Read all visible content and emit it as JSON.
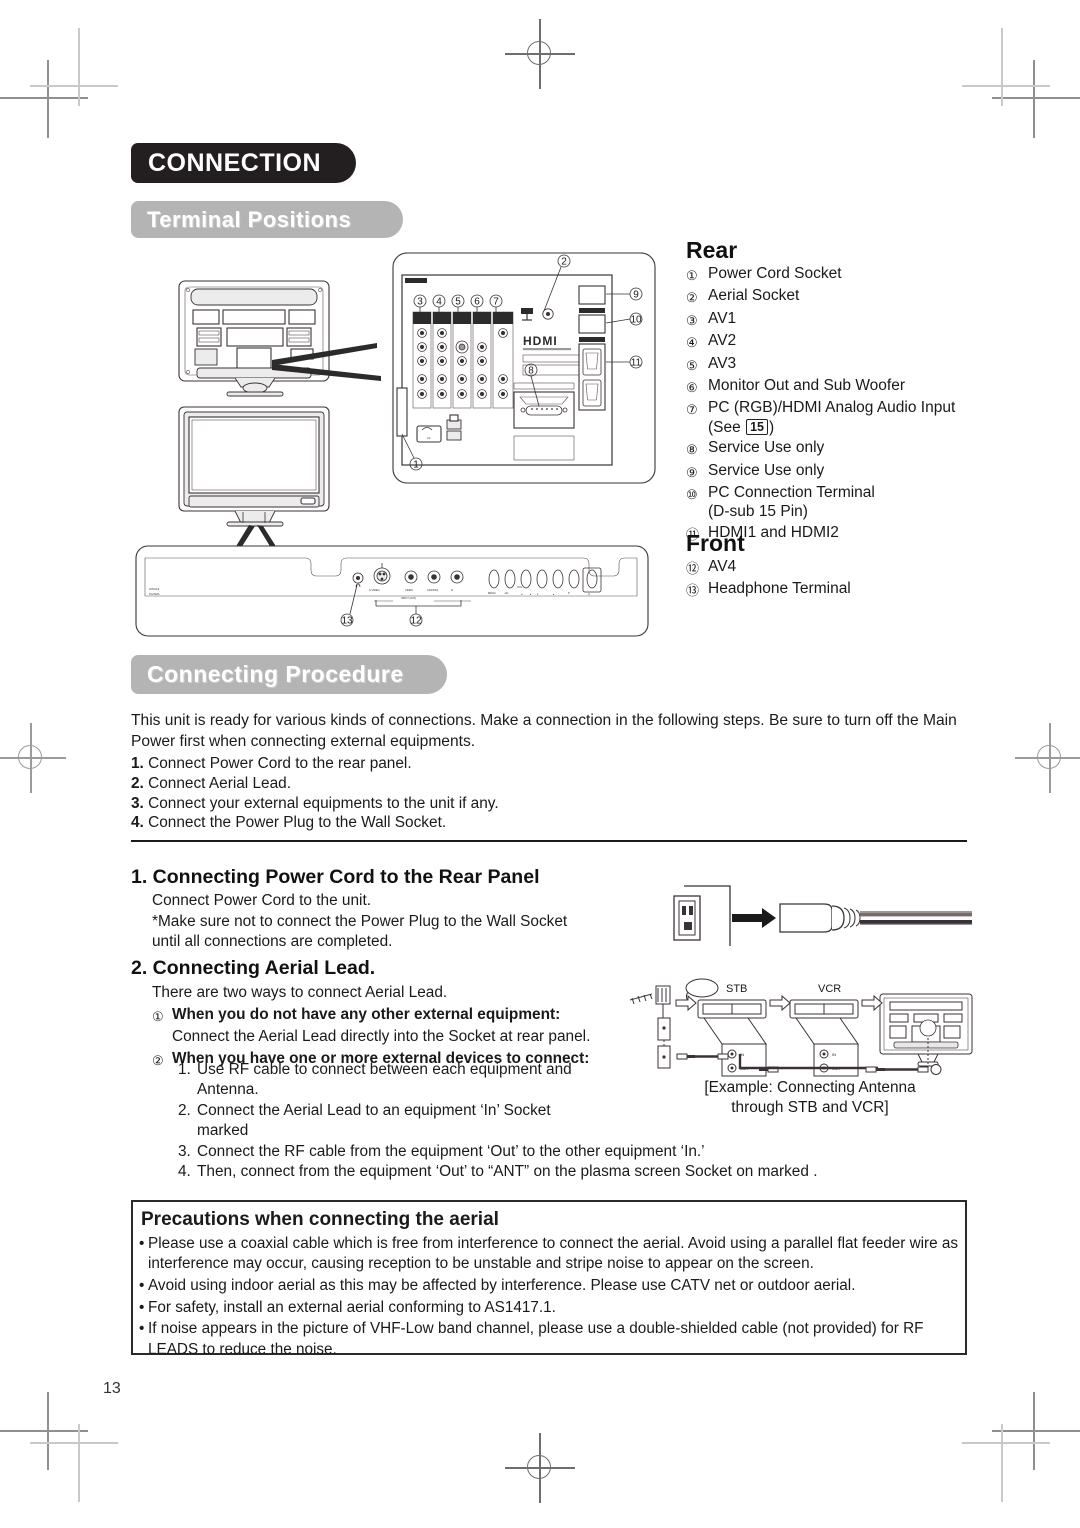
{
  "page": {
    "number": "13"
  },
  "chapter": {
    "title": "CONNECTION"
  },
  "sections": {
    "terminal_positions": {
      "title": "Terminal Positions"
    },
    "connecting_procedure": {
      "title": "Connecting Procedure"
    }
  },
  "terminals": {
    "rear_heading": "Rear",
    "front_heading": "Front",
    "rear": [
      {
        "num": "①",
        "label": "Power Cord Socket"
      },
      {
        "num": "②",
        "label": "Aerial Socket"
      },
      {
        "num": "③",
        "label": "AV1"
      },
      {
        "num": "④",
        "label": "AV2"
      },
      {
        "num": "⑤",
        "label": "AV3"
      },
      {
        "num": "⑥",
        "label": "Monitor Out and Sub Woofer"
      },
      {
        "num": "⑦",
        "label": "PC (RGB)/HDMI Analog Audio Input",
        "sub": "(See 15)",
        "see_ref": "15"
      },
      {
        "num": "⑧",
        "label": "Service Use only"
      },
      {
        "num": "⑨",
        "label": "Service Use only"
      },
      {
        "num": "⑩",
        "label": "PC Connection Terminal",
        "sub": "(D-sub 15 Pin)"
      },
      {
        "num": "⑪",
        "label": "HDMI1 and HDMI2"
      }
    ],
    "front": [
      {
        "num": "⑫",
        "label": "AV4"
      },
      {
        "num": "⑬",
        "label": "Headphone Terminal"
      }
    ]
  },
  "procedure": {
    "intro": "This unit is ready for various kinds of connections. Make a connection in the following steps. Be sure to turn off the Main Power first when connecting external equipments.",
    "steps": [
      {
        "num": "1.",
        "text": "Connect Power Cord to the rear panel."
      },
      {
        "num": "2.",
        "text": "Connect Aerial Lead."
      },
      {
        "num": "3.",
        "text": "Connect your external equipments to the unit if any."
      },
      {
        "num": "4.",
        "text": "Connect the Power Plug to the Wall Socket."
      }
    ]
  },
  "step1": {
    "heading": "1. Connecting Power Cord to the Rear Panel",
    "line1": "Connect Power Cord to the unit.",
    "line2": "*Make sure not to connect the Power Plug to the Wall Socket",
    "line3": "until all connections are completed."
  },
  "step2": {
    "heading": "2. Connecting Aerial Lead.",
    "intro": "There are two ways to connect Aerial Lead.",
    "case1_num": "①",
    "case1_title": "When you do not have any other external equipment:",
    "case1_desc": "Connect the Aerial Lead directly into the Socket at rear panel.",
    "case2_num": "②",
    "case2_title": "When you have one or more external devices to connect:",
    "items": [
      {
        "num": "1.",
        "line1": "Use RF cable to connect between each equipment and",
        "line2": "Antenna."
      },
      {
        "num": "2.",
        "line1": "Connect the Aerial Lead to an equipment ‘In’ Socket",
        "line2": "marked"
      },
      {
        "num": "3.",
        "line1": "Connect the RF cable from the equipment ‘Out’ to the other equipment ‘In.’",
        "line2": ""
      },
      {
        "num": "4.",
        "line1": "Then, connect from the equipment ‘Out’ to “ANT” on the plasma screen Socket on marked .",
        "line2": ""
      }
    ]
  },
  "antenna_diagram": {
    "caption_line1": "[Example: Connecting Antenna",
    "caption_line2": "through STB and VCR]",
    "stb_label": "STB",
    "vcr_label": "VCR",
    "in_label": "IN",
    "out_label": "OUT"
  },
  "precautions": {
    "heading": "Precautions when connecting the aerial",
    "bullet": "•",
    "items": [
      "Please use a coaxial cable which is free from interference to connect the aerial. Avoid using a parallel flat feeder wire as interference may occur, causing reception to be unstable and stripe noise to appear on the screen.",
      "Avoid using indoor aerial as this may be affected by interference. Please use CATV net or outdoor aerial.",
      "For safety, install an external aerial conforming to AS1417.1.",
      "If noise appears in the picture of VHF-Low band channel, please use a double-shielded cable (not provided) for RF LEADS to reduce the noise."
    ]
  },
  "rear_panel_diagram": {
    "callouts": [
      "②",
      "③",
      "④",
      "⑤",
      "⑥",
      "⑦",
      "⑧",
      "⑨",
      "⑩",
      "⑪",
      "①"
    ],
    "hdmi_logo": "HDMI",
    "ant_label": "ANT",
    "ac_label": "AC"
  },
  "front_panel_diagram": {
    "callouts": [
      "⑬",
      "⑫"
    ],
    "input_label": "INPUT (AV4)",
    "svideo_label": "S-VIDEO",
    "video_label": "VIDEO",
    "audio_label": "AUDIO"
  },
  "colors": {
    "chapter_bg": "#231f20",
    "section_bg": "#b4b4b4",
    "text": "#1a1a1a",
    "crop_mark": "#8f8f8f"
  }
}
